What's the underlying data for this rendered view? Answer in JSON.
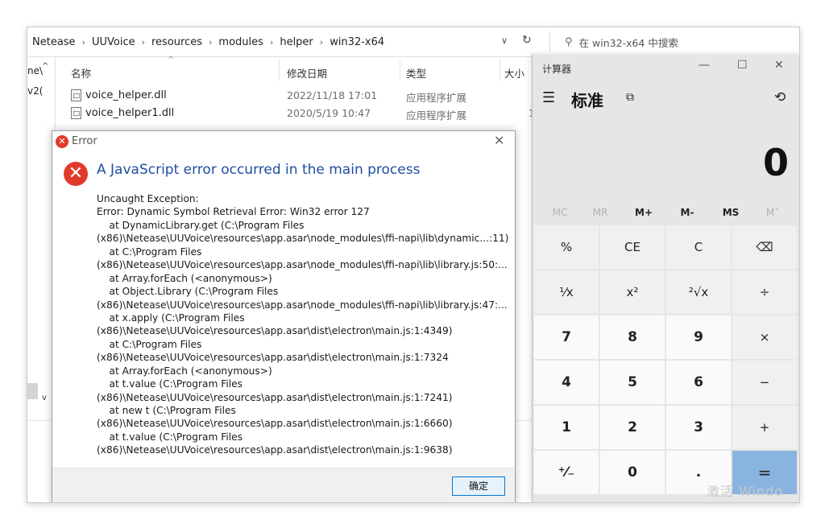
{
  "explorer": {
    "breadcrumbs": [
      "Netease",
      "UUVoice",
      "resources",
      "modules",
      "helper",
      "win32-x64"
    ],
    "search_placeholder": "在 win32-x64 中搜索",
    "nav_items": [
      "ne\\",
      "v2("
    ],
    "columns": {
      "name": "名称",
      "date": "修改日期",
      "type": "类型",
      "size": "大小"
    },
    "files": [
      {
        "name": "voice_helper.dll",
        "date": "2022/11/18 17:01",
        "type": "应用程序扩展",
        "size": ""
      },
      {
        "name": "voice_helper1.dll",
        "date": "2020/5/19 10:47",
        "type": "应用程序扩展",
        "size": "1"
      }
    ]
  },
  "dialog": {
    "title": "Error",
    "headline": "A JavaScript error occurred in the main process",
    "lines": [
      "Uncaught Exception:",
      "Error: Dynamic Symbol Retrieval Error: Win32 error 127",
      "    at DynamicLibrary.get (C:\\Program Files",
      "(x86)\\Netease\\UUVoice\\resources\\app.asar\\node_modules\\ffi-napi\\lib\\dynamic...:11)",
      "    at C:\\Program Files",
      "(x86)\\Netease\\UUVoice\\resources\\app.asar\\node_modules\\ffi-napi\\lib\\library.js:50:...",
      "    at Array.forEach (<anonymous>)",
      "    at Object.Library (C:\\Program Files",
      "(x86)\\Netease\\UUVoice\\resources\\app.asar\\node_modules\\ffi-napi\\lib\\library.js:47:...",
      "    at x.apply (C:\\Program Files",
      "(x86)\\Netease\\UUVoice\\resources\\app.asar\\dist\\electron\\main.js:1:4349)",
      "    at C:\\Program Files",
      "(x86)\\Netease\\UUVoice\\resources\\app.asar\\dist\\electron\\main.js:1:7324",
      "    at Array.forEach (<anonymous>)",
      "    at t.value (C:\\Program Files",
      "(x86)\\Netease\\UUVoice\\resources\\app.asar\\dist\\electron\\main.js:1:7241)",
      "    at new t (C:\\Program Files",
      "(x86)\\Netease\\UUVoice\\resources\\app.asar\\dist\\electron\\main.js:1:6660)",
      "    at t.value (C:\\Program Files",
      "(x86)\\Netease\\UUVoice\\resources\\app.asar\\dist\\electron\\main.js:1:9638)"
    ],
    "ok_label": "确定"
  },
  "calculator": {
    "title": "计算器",
    "mode": "标准",
    "display": "0",
    "memory": [
      {
        "label": "MC",
        "enabled": false
      },
      {
        "label": "MR",
        "enabled": false
      },
      {
        "label": "M+",
        "enabled": true
      },
      {
        "label": "M-",
        "enabled": true
      },
      {
        "label": "MS",
        "enabled": true
      },
      {
        "label": "M˅",
        "enabled": false
      }
    ],
    "keys": [
      {
        "label": "%",
        "kind": "fn",
        "name": "percent"
      },
      {
        "label": "CE",
        "kind": "fn",
        "name": "clear-entry"
      },
      {
        "label": "C",
        "kind": "fn",
        "name": "clear"
      },
      {
        "label": "⌫",
        "kind": "fn",
        "name": "backspace"
      },
      {
        "label": "¹⁄x",
        "kind": "fn",
        "name": "reciprocal"
      },
      {
        "label": "x²",
        "kind": "fn",
        "name": "square"
      },
      {
        "label": "²√x",
        "kind": "fn",
        "name": "square-root"
      },
      {
        "label": "÷",
        "kind": "fn",
        "name": "divide"
      },
      {
        "label": "7",
        "kind": "num",
        "name": "digit-7"
      },
      {
        "label": "8",
        "kind": "num",
        "name": "digit-8"
      },
      {
        "label": "9",
        "kind": "num",
        "name": "digit-9"
      },
      {
        "label": "×",
        "kind": "fn",
        "name": "multiply"
      },
      {
        "label": "4",
        "kind": "num",
        "name": "digit-4"
      },
      {
        "label": "5",
        "kind": "num",
        "name": "digit-5"
      },
      {
        "label": "6",
        "kind": "num",
        "name": "digit-6"
      },
      {
        "label": "−",
        "kind": "fn",
        "name": "subtract"
      },
      {
        "label": "1",
        "kind": "num",
        "name": "digit-1"
      },
      {
        "label": "2",
        "kind": "num",
        "name": "digit-2"
      },
      {
        "label": "3",
        "kind": "num",
        "name": "digit-3"
      },
      {
        "label": "+",
        "kind": "fn",
        "name": "add"
      },
      {
        "label": "⁺⁄₋",
        "kind": "num",
        "name": "negate"
      },
      {
        "label": "0",
        "kind": "num",
        "name": "digit-0"
      },
      {
        "label": ".",
        "kind": "num",
        "name": "decimal"
      },
      {
        "label": "=",
        "kind": "eq",
        "name": "equals"
      }
    ],
    "watermark": "激活 Windo"
  }
}
